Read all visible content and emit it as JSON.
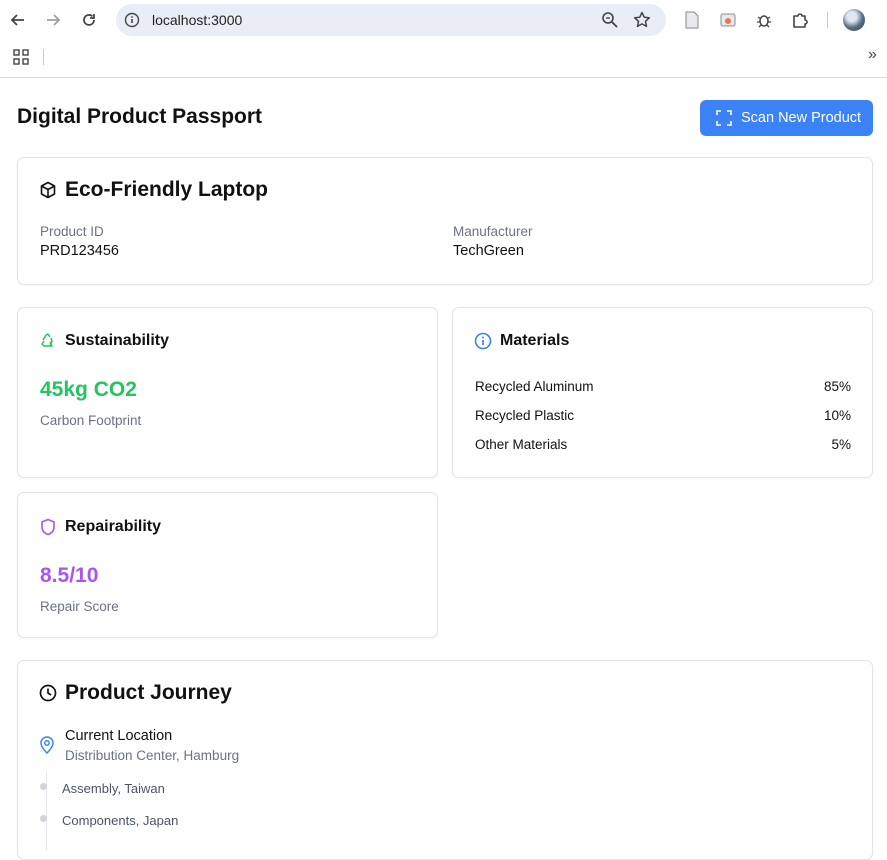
{
  "browser": {
    "url": "localhost:3000"
  },
  "header": {
    "title": "Digital Product Passport",
    "scan_button_label": "Scan New Product"
  },
  "product": {
    "name": "Eco-Friendly Laptop",
    "id_label": "Product ID",
    "id_value": "PRD123456",
    "manufacturer_label": "Manufacturer",
    "manufacturer_value": "TechGreen"
  },
  "sustainability": {
    "title": "Sustainability",
    "value": "45kg CO2",
    "caption": "Carbon Footprint",
    "color": "#22c55e"
  },
  "materials": {
    "title": "Materials",
    "items": [
      {
        "name": "Recycled Aluminum",
        "percent": "85%"
      },
      {
        "name": "Recycled Plastic",
        "percent": "10%"
      },
      {
        "name": "Other Materials",
        "percent": "5%"
      }
    ],
    "color": "#3b82f6"
  },
  "repairability": {
    "title": "Repairability",
    "value": "8.5/10",
    "caption": "Repair Score",
    "color": "#a855f7"
  },
  "journey": {
    "title": "Product Journey",
    "current_label": "Current Location",
    "current_value": "Distribution Center, Hamburg",
    "stops": [
      {
        "label": "Assembly, Taiwan"
      },
      {
        "label": "Components, Japan"
      }
    ]
  },
  "icons": {
    "product": "cube-icon",
    "sustainability": "recycle-icon",
    "materials": "info-icon",
    "repairability": "shield-icon",
    "journey": "clock-icon",
    "location": "map-pin-icon",
    "scan": "scan-icon"
  }
}
